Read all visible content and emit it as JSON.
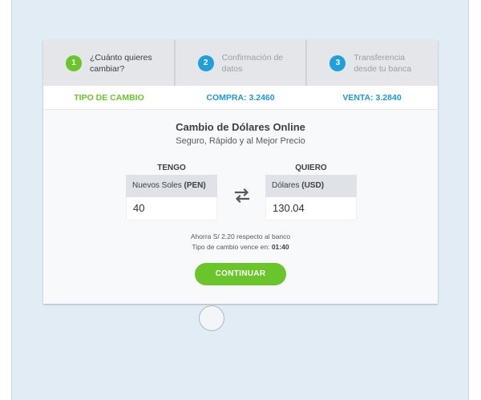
{
  "steps": [
    {
      "number": "1",
      "label": "¿Cuánto quieres\ncambiar?",
      "state": "active"
    },
    {
      "number": "2",
      "label": "Confirmación de\ndatos",
      "state": "pending"
    },
    {
      "number": "3",
      "label": "Transferencia\ndesde tu banca",
      "state": "pending"
    }
  ],
  "rates": {
    "type_label": "TIPO DE CAMBIO",
    "buy": "COMPRA: 3.2460",
    "sell": "VENTA: 3.2840"
  },
  "main": {
    "title": "Cambio de Dólares Online",
    "subtitle": "Seguro, Rápido y al Mejor Precio"
  },
  "exchange": {
    "have": {
      "heading": "TENGO",
      "currency_name": "Nuevos Soles ",
      "currency_code": "(PEN)",
      "amount": "40"
    },
    "want": {
      "heading": "QUIERO",
      "currency_name": "Dólares ",
      "currency_code": "(USD)",
      "amount": "130.04"
    },
    "swap_icon": "swap-arrows-icon"
  },
  "info": {
    "savings": "Ahorra S/ 2.20 respecto al banco",
    "expires_prefix": "Tipo de cambio vence en: ",
    "expires_time": "01:40"
  },
  "continue_label": "CONTINUAR",
  "colors": {
    "green": "#6ac52a",
    "blue": "#1a9ad6",
    "background": "#e1ecf5"
  }
}
